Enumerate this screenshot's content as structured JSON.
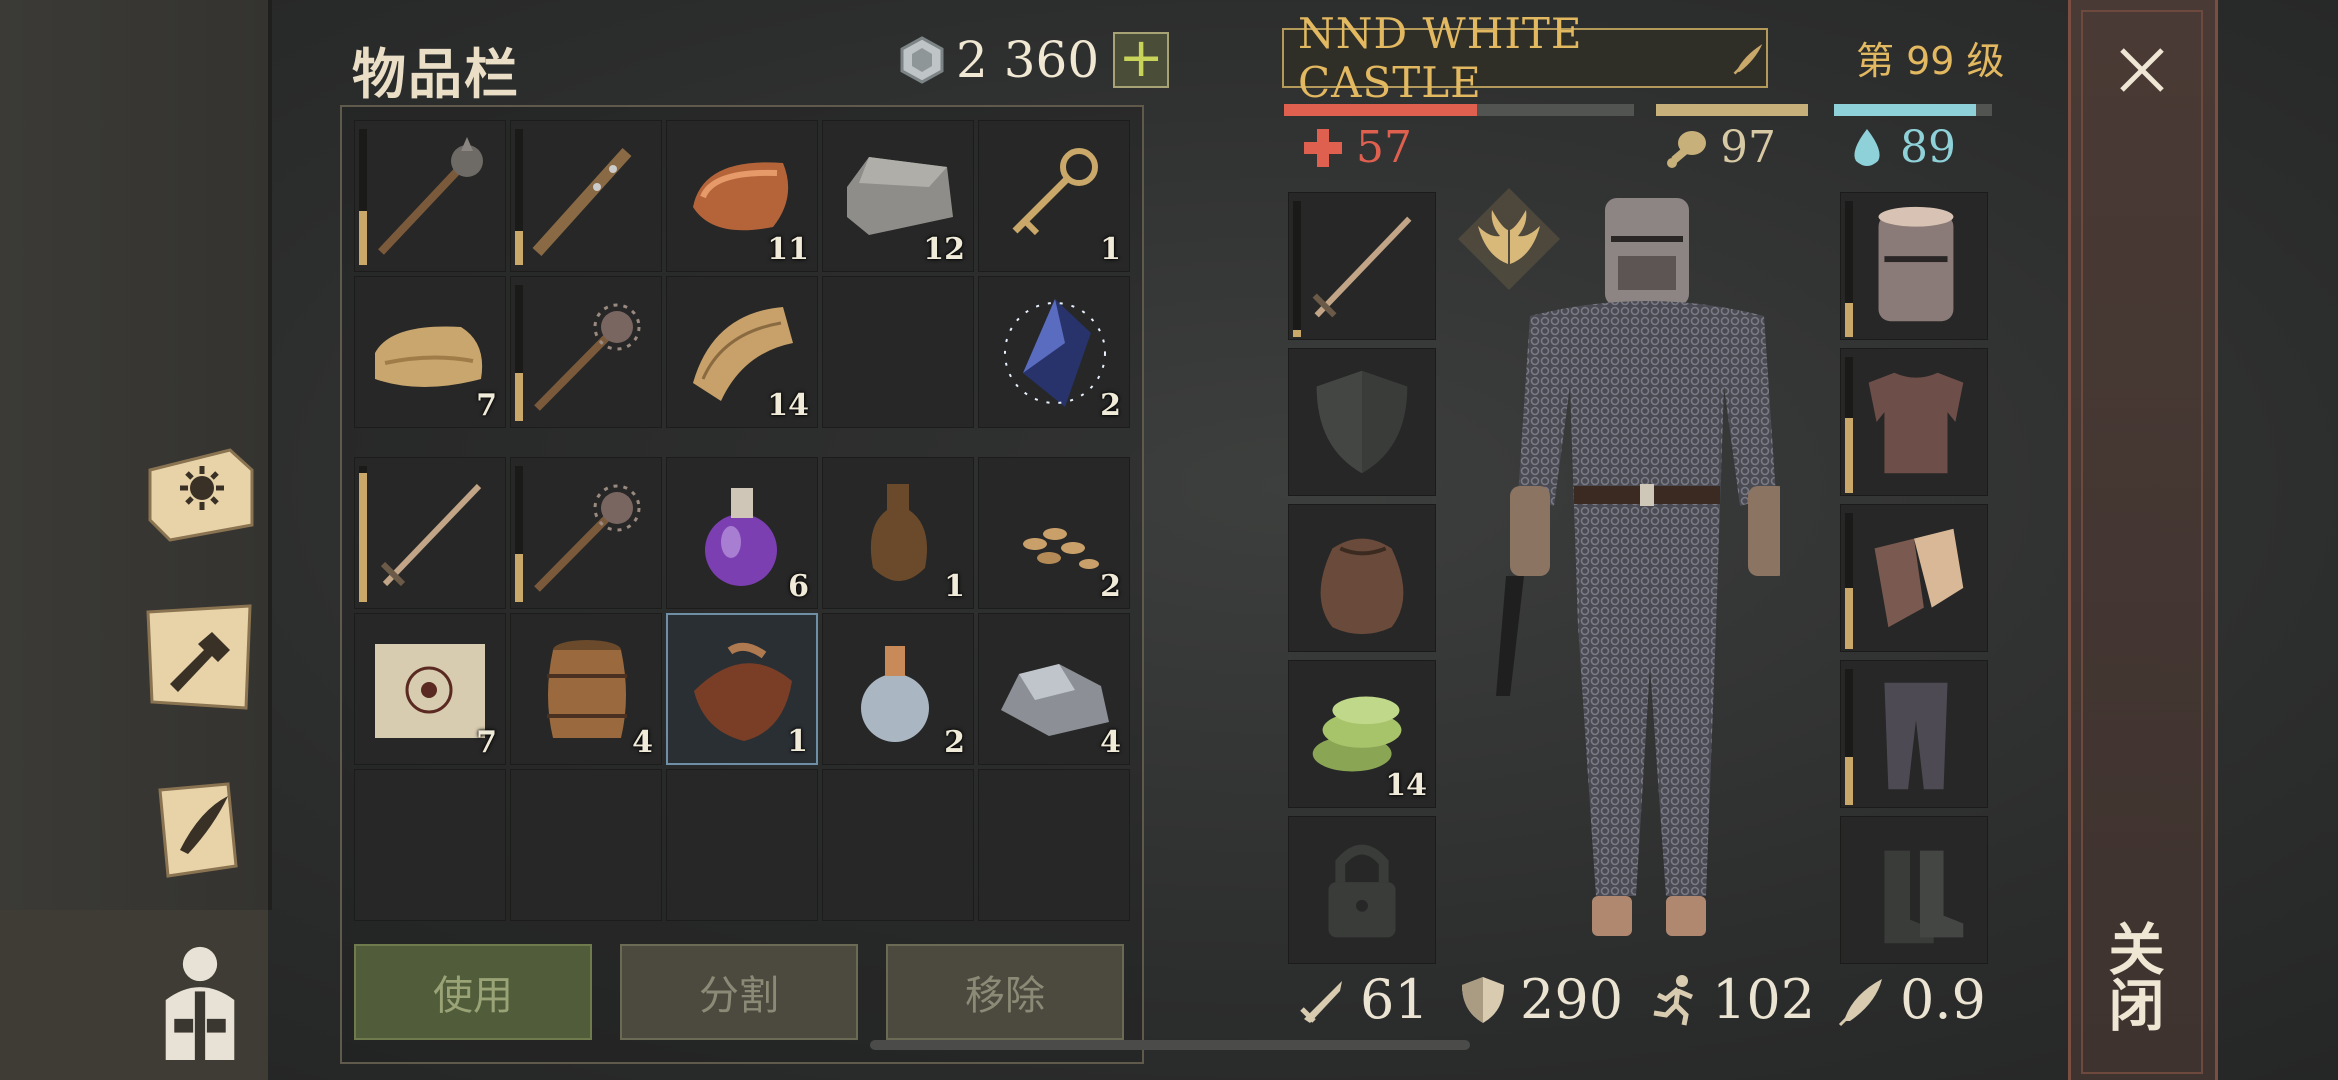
{
  "inventory": {
    "title": "物品栏",
    "currency": "2 360",
    "add_label": "+",
    "rows_top": [
      [
        {
          "icon": "mace-icon",
          "qty": "",
          "dur": 0.4
        },
        {
          "icon": "spiked-club-icon",
          "qty": "",
          "dur": 0.25
        },
        {
          "icon": "copper-ingot-icon",
          "qty": "11"
        },
        {
          "icon": "stone-block-icon",
          "qty": "12"
        },
        {
          "icon": "key-icon",
          "qty": "1"
        }
      ],
      [
        {
          "icon": "cloth-roll-icon",
          "qty": "7"
        },
        {
          "icon": "morningstar-icon",
          "qty": "",
          "dur": 0.35
        },
        {
          "icon": "rope-fibers-icon",
          "qty": "14"
        },
        {
          "icon": "",
          "qty": ""
        },
        {
          "icon": "crystal-icon",
          "qty": "2"
        }
      ]
    ],
    "rows_bottom": [
      [
        {
          "icon": "sword-icon",
          "qty": "",
          "dur": 0.95
        },
        {
          "icon": "morningstar-icon",
          "qty": "",
          "dur": 0.35
        },
        {
          "icon": "potion-icon",
          "qty": "6"
        },
        {
          "icon": "bottle-icon",
          "qty": "1"
        },
        {
          "icon": "seeds-icon",
          "qty": "2"
        }
      ],
      [
        {
          "icon": "scroll-icon",
          "qty": "7"
        },
        {
          "icon": "barrel-icon",
          "qty": "4"
        },
        {
          "icon": "saddle-icon",
          "qty": "1",
          "selected": true
        },
        {
          "icon": "flask-icon",
          "qty": "2"
        },
        {
          "icon": "ore-icon",
          "qty": "4"
        }
      ],
      [
        {
          "icon": "",
          "qty": ""
        },
        {
          "icon": "",
          "qty": ""
        },
        {
          "icon": "",
          "qty": ""
        },
        {
          "icon": "",
          "qty": ""
        },
        {
          "icon": "",
          "qty": ""
        }
      ]
    ],
    "buttons": {
      "use": "使用",
      "split": "分割",
      "remove": "移除"
    }
  },
  "character": {
    "name": "NND WHITE CASTLE",
    "level": "第 99 级",
    "health": "57",
    "food": "97",
    "water": "89",
    "health_fraction": 0.55,
    "food_fraction": 1.0,
    "water_fraction": 0.9,
    "left_slots": [
      {
        "icon": "sword-icon",
        "qty": "",
        "dur": 0.05
      },
      {
        "icon": "shield-empty-icon",
        "qty": ""
      },
      {
        "icon": "pouch-icon",
        "qty": ""
      },
      {
        "icon": "food-icon",
        "qty": "14"
      },
      {
        "icon": "lock-icon",
        "qty": ""
      }
    ],
    "right_slots": [
      {
        "icon": "helmet-icon",
        "dur": 0.25
      },
      {
        "icon": "chainmail-icon",
        "dur": 0.55
      },
      {
        "icon": "gloves-icon",
        "dur": 0.45
      },
      {
        "icon": "leggings-icon",
        "dur": 0.35
      },
      {
        "icon": "boots-empty-icon"
      }
    ],
    "stats": {
      "attack": "61",
      "armor": "290",
      "speed": "102",
      "weight": "0.9"
    }
  },
  "close": {
    "label": "关闭"
  },
  "colors": {
    "health": "#e0604f",
    "food": "#c7b07a",
    "water": "#8fd1d8",
    "gold": "#e2b860"
  }
}
